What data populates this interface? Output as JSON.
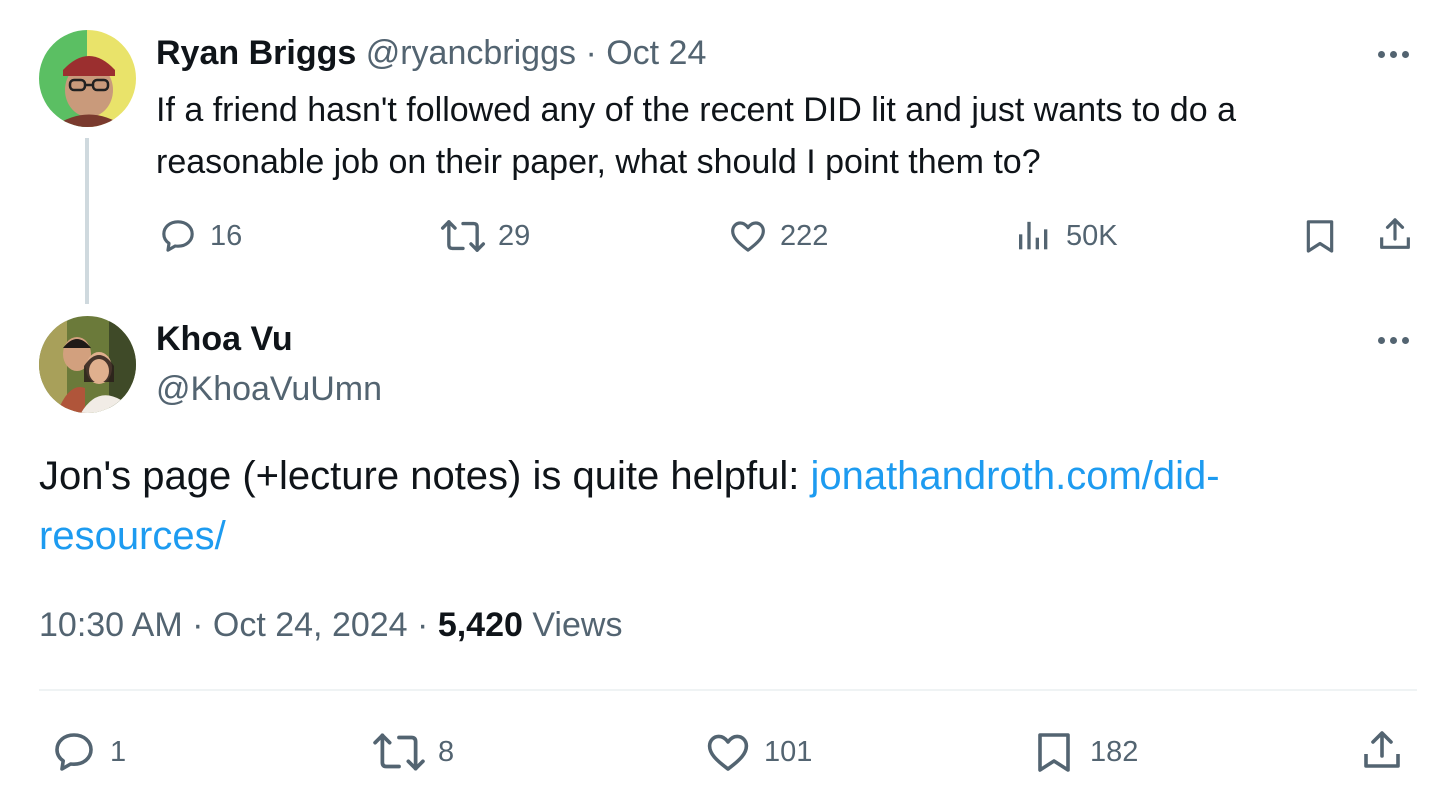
{
  "tweet1": {
    "name": "Ryan Briggs",
    "handle": "@ryancbriggs",
    "sep": "·",
    "date": "Oct 24",
    "text_line1": "If a friend hasn't followed any of the recent DID lit and just wants to do a",
    "text_line2": "reasonable job on their paper, what should I point them to?",
    "replies": "16",
    "reposts": "29",
    "likes": "222",
    "views": "50K"
  },
  "tweet2": {
    "name": "Khoa Vu",
    "handle": "@KhoaVuUmn",
    "text_prefix": "Jon's page (+lecture notes) is quite helpful: ",
    "link_line1": "jonathandroth.com/did-",
    "link_line2": "resources/",
    "time": "10:30 AM",
    "sep1": "·",
    "date": "Oct 24, 2024",
    "sep2": "·",
    "views_count": "5,420",
    "views_label": "Views",
    "replies": "1",
    "reposts": "8",
    "likes": "101",
    "bookmarks": "182"
  },
  "colors": {
    "text": "#0f1419",
    "muted": "#536471",
    "link": "#1d9bf0",
    "divider": "#eff3f4",
    "thread_line": "#cfd9de"
  },
  "icons": [
    "reply-icon",
    "repost-icon",
    "like-icon",
    "views-icon",
    "bookmark-icon",
    "share-icon",
    "more-icon"
  ]
}
